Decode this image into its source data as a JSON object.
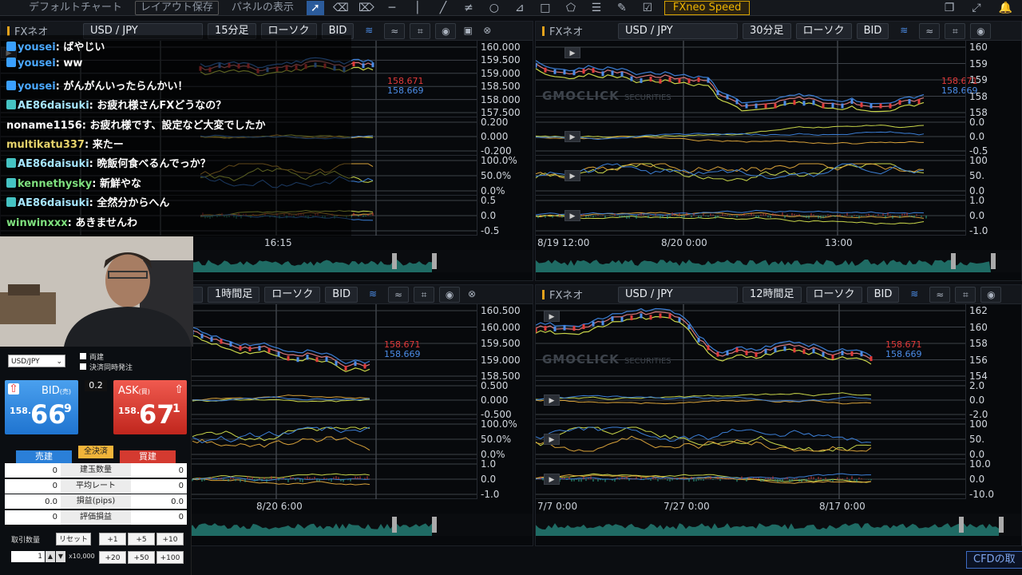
{
  "topbar": {
    "items": [
      "デフォルトチャート",
      "レイアウト保存",
      "パネルの表示"
    ],
    "speed_label": "FXneo Speed",
    "tools": [
      "cursor",
      "eraser",
      "eraser-all",
      "hline",
      "vline",
      "trendline",
      "channel",
      "circle",
      "fib",
      "rect",
      "pentagon",
      "lines",
      "pencil",
      "check"
    ]
  },
  "panels": {
    "tl": {
      "interval": "15分足",
      "ctype": "ローソク",
      "side": "BID",
      "yticks": [
        "160.000",
        "159.500",
        "159.000",
        "158.500",
        "158.000",
        "157.500"
      ],
      "osc1": [
        "0.200",
        "0.000",
        "-0.200"
      ],
      "osc2": [
        "100.0%",
        "50.0%",
        "0.0%"
      ],
      "osc3": [
        "0.5",
        "0.0",
        "-0.5"
      ],
      "xticks": [
        "16:15"
      ],
      "ask_price": "158.671",
      "bid_price": "158.669"
    },
    "tr": {
      "name": "FXネオ",
      "symbol": "USD / JPY",
      "interval": "30分足",
      "ctype": "ローソク",
      "side": "BID",
      "yticks": [
        "160",
        "159",
        "159",
        "158",
        "158"
      ],
      "osc1": [
        "0.0",
        "0.0",
        "-0.5"
      ],
      "osc2": [
        "100",
        "50.",
        "0.0"
      ],
      "osc3": [
        "1.0",
        "0.0",
        "-1.0"
      ],
      "xticks": [
        "8/19 12:00",
        "8/20 0:00",
        "13:00"
      ],
      "ask_price": "158.671",
      "bid_price": "158.669",
      "watermark": "GMOCLICK",
      "watermark_sub": "SECURITIES"
    },
    "bl": {
      "interval": "1時間足",
      "ctype": "ローソク",
      "side": "BID",
      "yticks": [
        "160.500",
        "160.000",
        "159.500",
        "159.000",
        "158.500"
      ],
      "osc1": [
        "0.500",
        "0.000",
        "-0.500"
      ],
      "osc2": [
        "100.0%",
        "50.0%",
        "0.0%"
      ],
      "osc3": [
        "1.0",
        "0.0",
        "-1.0"
      ],
      "xticks": [
        "8/20 6:00"
      ],
      "ask_price": "158.671",
      "bid_price": "158.669"
    },
    "br": {
      "name": "FXネオ",
      "symbol": "USD / JPY",
      "interval": "12時間足",
      "ctype": "ローソク",
      "side": "BID",
      "yticks": [
        "162",
        "160",
        "158",
        "156",
        "154"
      ],
      "osc1": [
        "2.0",
        "0.0",
        "-2.0"
      ],
      "osc2": [
        "100",
        "50.",
        "0.0"
      ],
      "osc3": [
        "10.0",
        "0.0",
        "-10.0"
      ],
      "xticks": [
        "7/7 0:00",
        "7/27 0:00",
        "8/17 0:00"
      ],
      "ask_price": "158.671",
      "bid_price": "158.669",
      "watermark": "GMOCLICK",
      "watermark_sub": "SECURITIES"
    }
  },
  "tl_header": {
    "name": "FXネオ",
    "symbol": "USD / JPY"
  },
  "chat": [
    {
      "user": "yousei",
      "text": "ばやじい",
      "color": "#4aa8ff",
      "badge": "#3aa0ff"
    },
    {
      "user": "yousei",
      "text": "ww",
      "color": "#4aa8ff",
      "badge": "#3aa0ff"
    },
    {
      "user": "yousei",
      "text": "がんがんいったらんかい！",
      "color": "#4aa8ff",
      "badge": "#3aa0ff"
    },
    {
      "user": "AE86daisuki",
      "text": "お疲れ様さんFXどうなの？",
      "color": "#a7e6ff",
      "badge": "#45c3c3"
    },
    {
      "user": "noname1156",
      "text": "お疲れ様です、設定など大変でしたか",
      "color": "#ffffff",
      "badge": ""
    },
    {
      "user": "multikatu337",
      "text": "来たー",
      "color": "#e6d36b",
      "badge": ""
    },
    {
      "user": "AE86daisuki",
      "text": "晩飯何食べるんでっか？",
      "color": "#a7e6ff",
      "badge": "#45c3c3"
    },
    {
      "user": "kennethysky",
      "text": "新鮮やな",
      "color": "#7ee07e",
      "badge": "#45c3c3"
    },
    {
      "user": "AE86daisuki",
      "text": "全然分からへん",
      "color": "#a7e6ff",
      "badge": "#45c3c3"
    },
    {
      "user": "winwinxxx",
      "text": "あきませんわ",
      "color": "#7ee07e",
      "badge": ""
    }
  ],
  "order": {
    "symbol": "USD/JPY",
    "opt1": "両建",
    "opt2": "決済同時発注",
    "spread": "0.2",
    "bid_label": "BID",
    "bid_unit": "(売)",
    "bid_prefix": "158.",
    "bid_big": "66",
    "bid_sup": "9",
    "ask_label": "ASK",
    "ask_unit": "(買)",
    "ask_prefix": "158.",
    "ask_big": "67",
    "ask_sup": "1",
    "sell_tab": "売建",
    "all_close": "全決済",
    "buy_tab": "買建",
    "rows": [
      {
        "l": "0",
        "m": "建玉数量",
        "r": "0"
      },
      {
        "l": "0",
        "m": "平均レート",
        "r": "0"
      },
      {
        "l": "0.0",
        "m": "損益(pips)",
        "r": "0.0"
      },
      {
        "l": "0",
        "m": "評価損益",
        "r": "0"
      }
    ],
    "qty_label": "取引数量",
    "reset": "リセット",
    "inc": [
      "+1",
      "+5",
      "+10",
      "+20",
      "+50",
      "+100"
    ],
    "qty_value": "1",
    "unit": "x10,000"
  },
  "cfd_label": "CFDの取"
}
